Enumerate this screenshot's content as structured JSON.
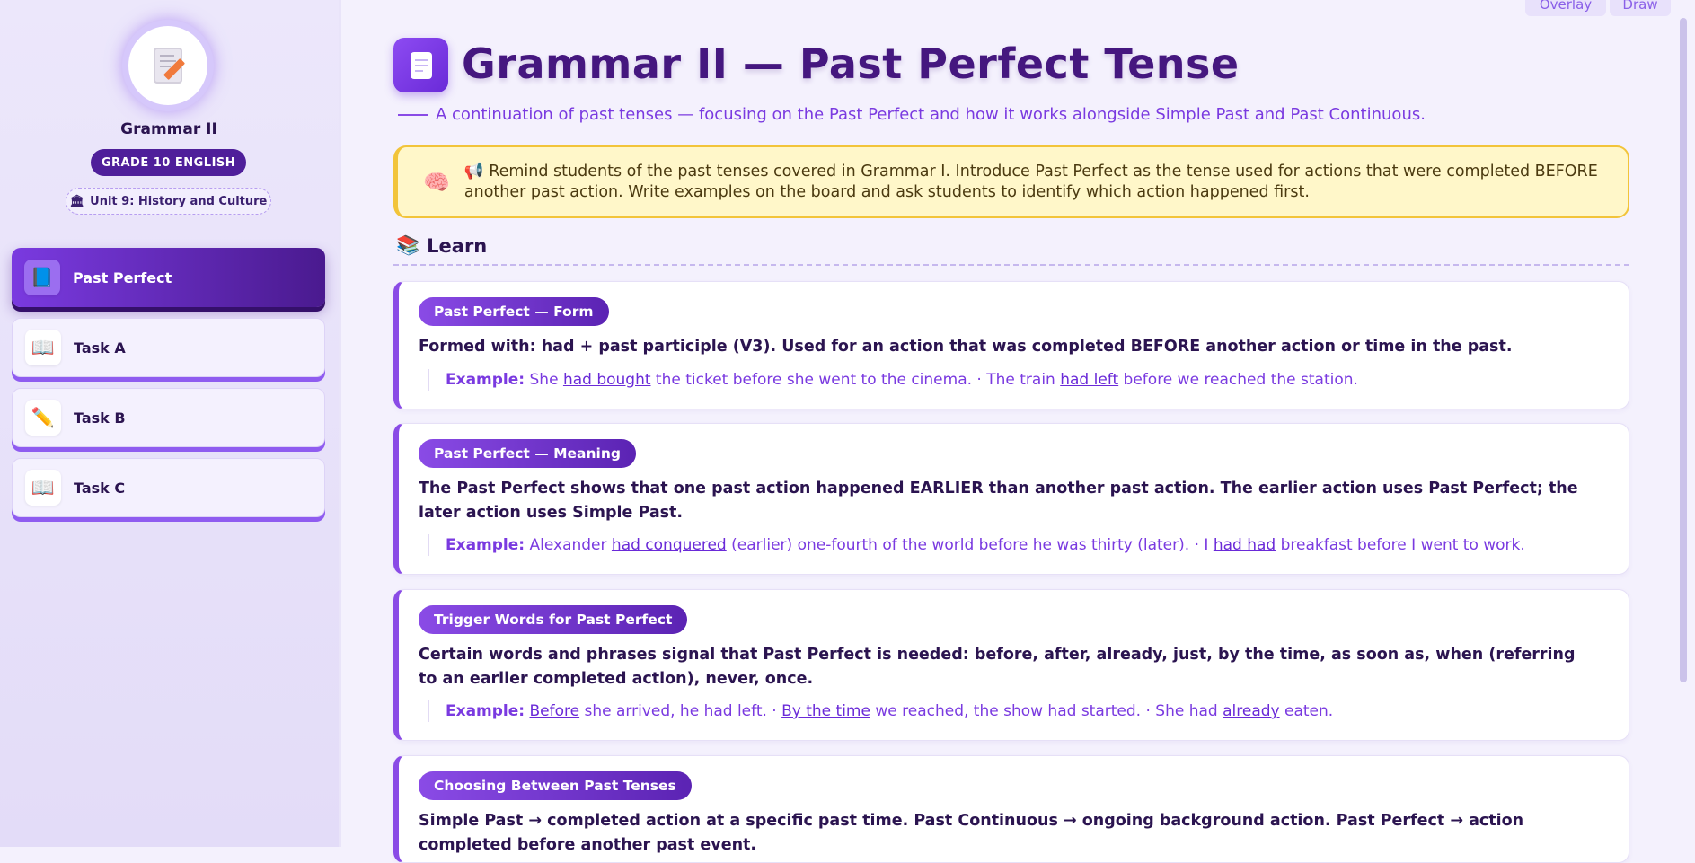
{
  "sidebar": {
    "title": "Grammar II",
    "grade": "GRADE 10 ENGLISH",
    "unit_icon": "🏛",
    "unit": "Unit 9: History and Culture",
    "items": [
      {
        "label": "Past Perfect",
        "icon": "📘",
        "active": true
      },
      {
        "label": "Task A",
        "icon": "📖",
        "active": false
      },
      {
        "label": "Task B",
        "icon": "✏️",
        "active": false
      },
      {
        "label": "Task C",
        "icon": "📖",
        "active": false
      }
    ]
  },
  "toolbar": {
    "overlay_label": "Overlay",
    "draw_label": "Draw"
  },
  "header": {
    "title": "Grammar II — Past Perfect Tense",
    "subtitle": "A continuation of past tenses — focusing on the Past Perfect and how it works alongside Simple Past and Past Continuous."
  },
  "teacher_note": {
    "icon": "🧠",
    "text": "📢 Remind students of the past tenses covered in Grammar I. Introduce Past Perfect as the tense used for actions that were completed BEFORE another past action. Write examples on the board and ask students to identify which action happened first."
  },
  "learn": {
    "icon": "📚",
    "heading": "Learn",
    "example_label": "Example:",
    "cards": [
      {
        "title": "Past Perfect — Form",
        "body": "Formed with: had + past participle (V3). Used for an action that was completed BEFORE another action or time in the past.",
        "example_parts": [
          "She ",
          "had bought",
          " the ticket before she went to the cinema. · The train ",
          "had left",
          " before we reached the station."
        ]
      },
      {
        "title": "Past Perfect — Meaning",
        "body": "The Past Perfect shows that one past action happened EARLIER than another past action. The earlier action uses Past Perfect; the later action uses Simple Past.",
        "example_parts": [
          "Alexander ",
          "had conquered",
          " (earlier) one-fourth of the world before he was thirty (later). · I ",
          "had had",
          " breakfast before I went to work."
        ]
      },
      {
        "title": "Trigger Words for Past Perfect",
        "body": "Certain words and phrases signal that Past Perfect is needed: before, after, already, just, by the time, as soon as, when (referring to an earlier completed action), never, once.",
        "example_parts": [
          "",
          "Before",
          " she arrived, he had left. · ",
          "By the time",
          " we reached, the show had started. · She had ",
          "already",
          " eaten."
        ]
      },
      {
        "title": "Choosing Between Past Tenses",
        "body": "Simple Past → completed action at a specific past time. Past Continuous → ongoing background action. Past Perfect → action completed before another past event."
      }
    ]
  }
}
